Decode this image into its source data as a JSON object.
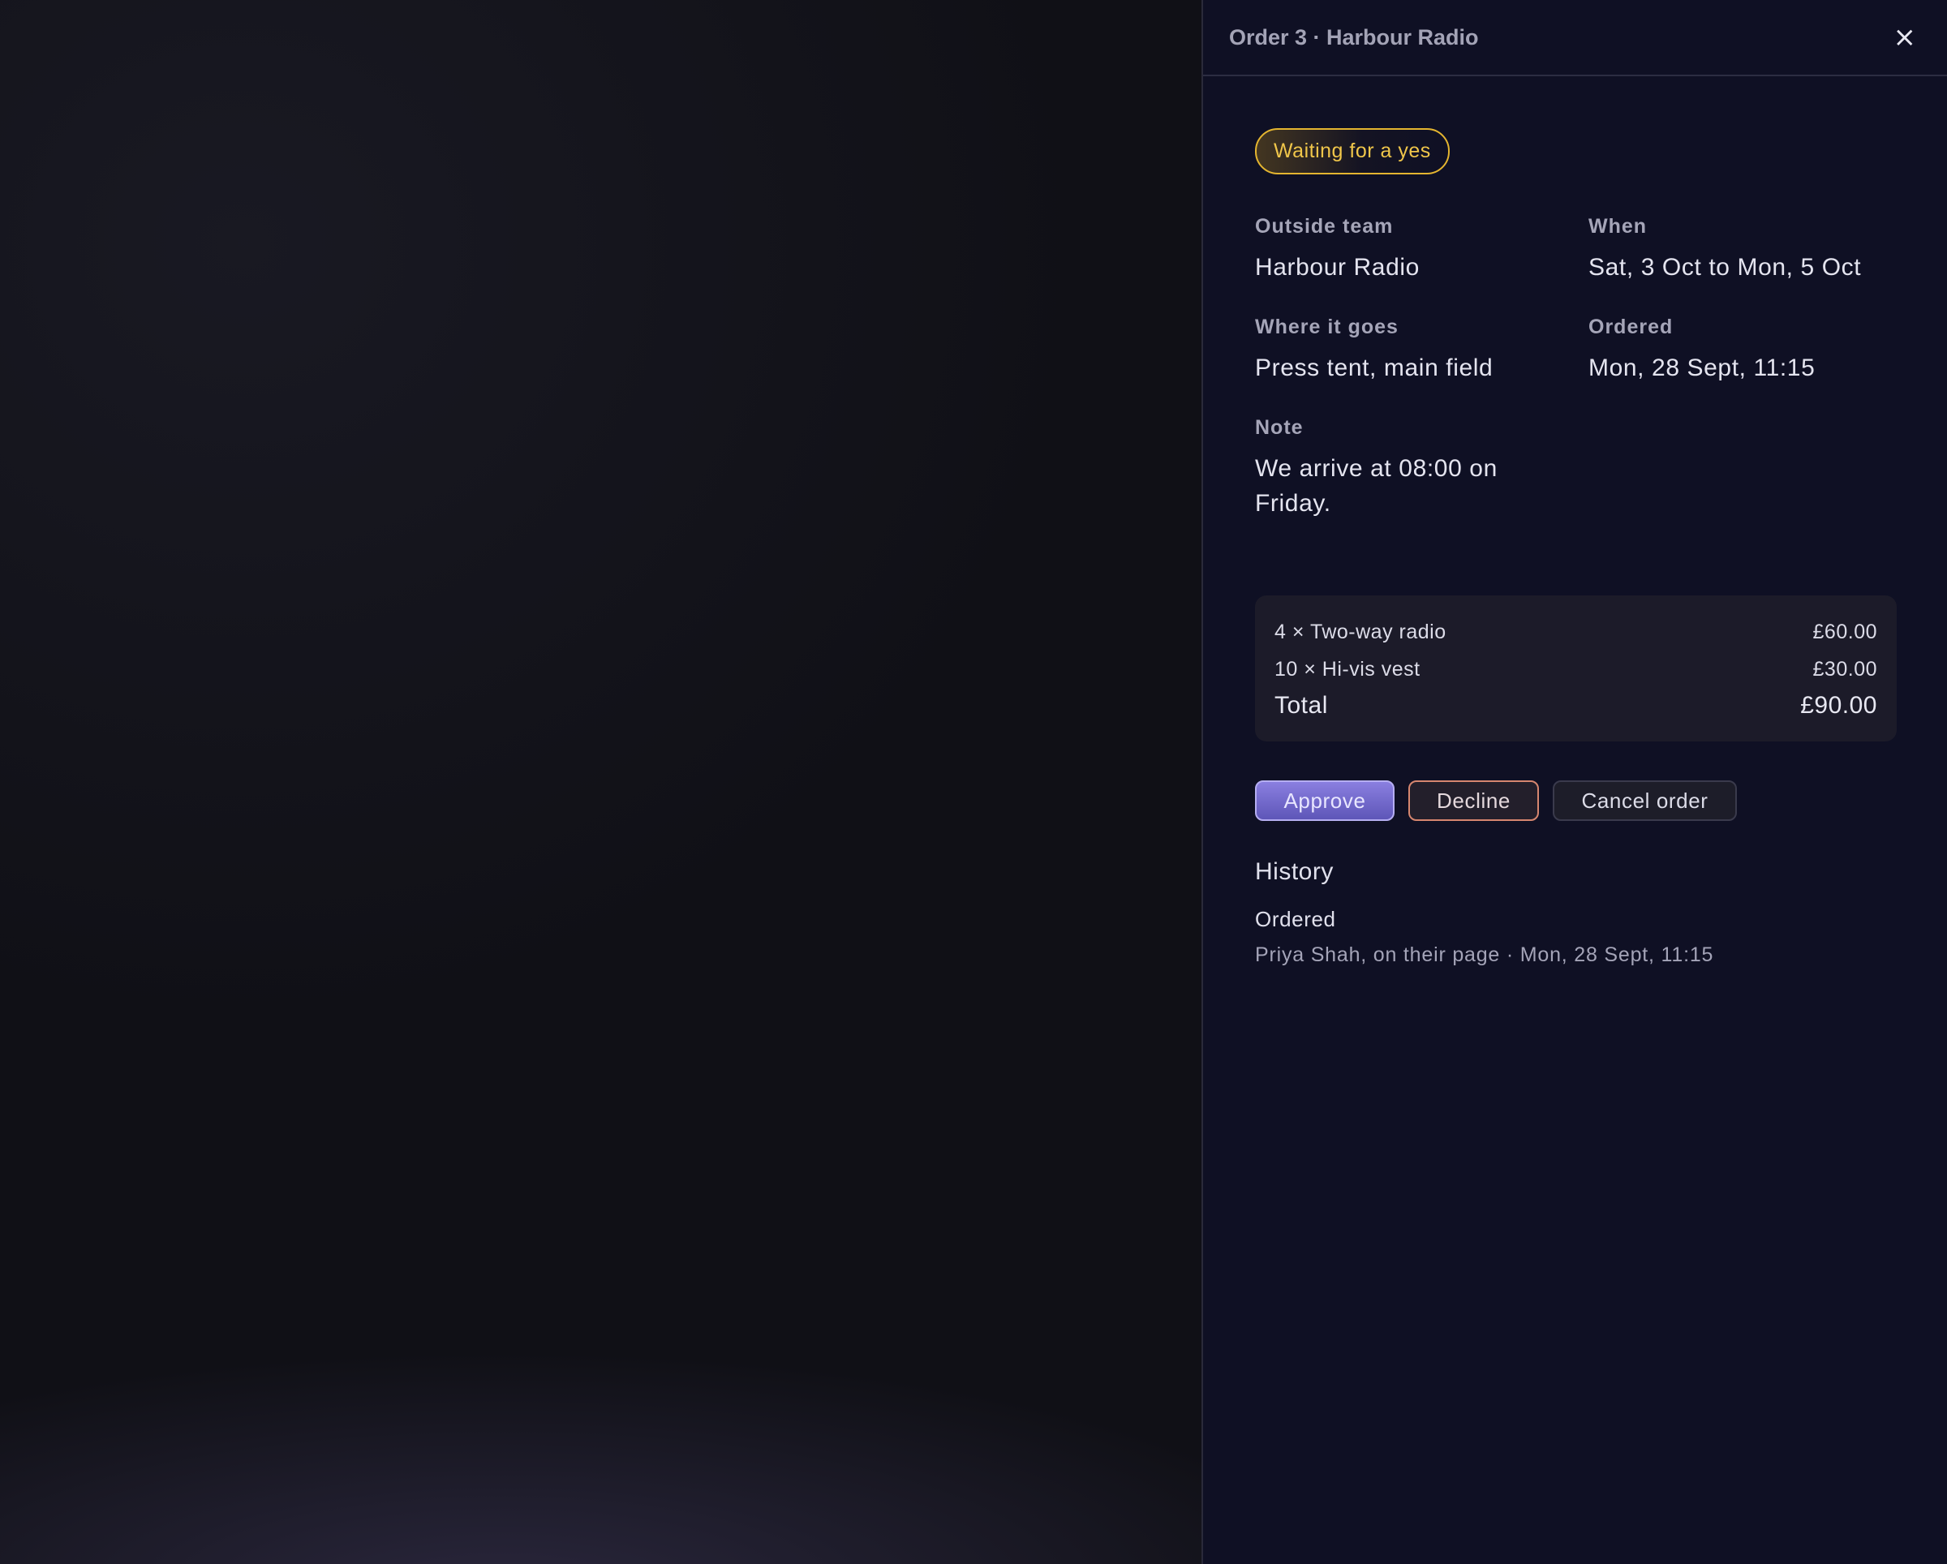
{
  "panel": {
    "title": "Order 3 · Harbour Radio",
    "close_label": "×"
  },
  "status": {
    "label": "Waiting for a yes",
    "color": "#f0c64a"
  },
  "details": {
    "outside_team_label": "Outside team",
    "outside_team_value": "Harbour Radio",
    "when_label": "When",
    "when_value": "Sat, 3 Oct to Mon, 5 Oct",
    "where_label": "Where it goes",
    "where_value": "Press tent, main field",
    "ordered_label": "Ordered",
    "ordered_value": "Mon, 28 Sept, 11:15",
    "note_label": "Note",
    "note_value": "We arrive at 08:00 on Friday."
  },
  "items": [
    {
      "description": "4 × Two-way radio",
      "price": "£60.00"
    },
    {
      "description": "10 × Hi-vis vest",
      "price": "£30.00"
    }
  ],
  "total": {
    "label": "Total",
    "value": "£90.00"
  },
  "actions": {
    "approve_label": "Approve",
    "decline_label": "Decline",
    "cancel_label": "Cancel order"
  },
  "history": {
    "heading": "History",
    "events": [
      {
        "title": "Ordered",
        "meta": "Priya Shah, on their page · Mon, 28 Sept, 11:15"
      }
    ]
  },
  "colors": {
    "accent": "#7d73d8",
    "decline": "#d6866f",
    "panel_background": "#0f1024"
  }
}
